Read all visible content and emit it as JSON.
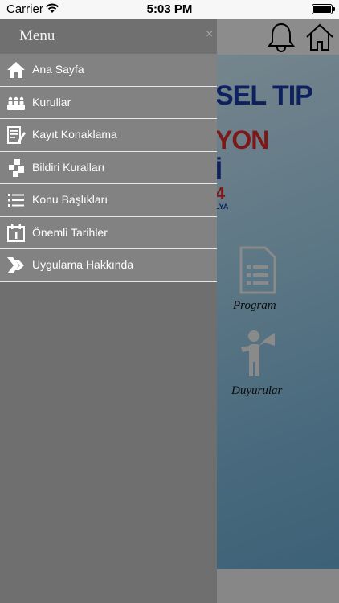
{
  "status_bar": {
    "carrier": "Carrier",
    "time": "5:03 PM"
  },
  "background": {
    "poster_lines": [
      "SEL TIP",
      "YON",
      "İ",
      "4",
      "LYA"
    ],
    "program_label": "Program",
    "announcements_label": "Duyurular"
  },
  "drawer": {
    "title": "Menu",
    "close": "×",
    "items": [
      {
        "label": "Ana Sayfa",
        "icon": "home-icon"
      },
      {
        "label": "Kurullar",
        "icon": "committee-icon"
      },
      {
        "label": "Kayıt Konaklama",
        "icon": "registration-icon"
      },
      {
        "label": "Bildiri Kuralları",
        "icon": "rules-icon"
      },
      {
        "label": "Konu Başlıkları",
        "icon": "list-icon"
      },
      {
        "label": "Önemli Tarihler",
        "icon": "calendar-icon"
      },
      {
        "label": "Uygulama Hakkında",
        "icon": "about-icon"
      }
    ]
  },
  "colors": {
    "drawer_bg": "#6f6f6f",
    "menu_item_bg": "#828282",
    "separator": "#e6e6e6"
  }
}
